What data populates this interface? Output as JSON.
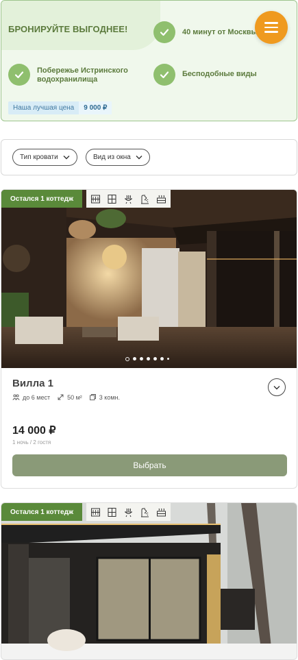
{
  "promo": {
    "title": "БРОНИРУЙТЕ ВЫГОДНЕЕ!",
    "features": [
      "40 минут от Москвы",
      "Побережье Истринского водохранилища",
      "Бесподобные виды"
    ],
    "price_label": "Наша лучшая цена",
    "price_value": "9 000 ₽"
  },
  "menu": {
    "icon": "hamburger-icon",
    "color": "#ef9a1f"
  },
  "filters": [
    {
      "label": "Тип кровати"
    },
    {
      "label": "Вид из окна"
    }
  ],
  "cards": [
    {
      "badge": "Остался 1 коттедж",
      "amenities": [
        "radiator-icon",
        "window-icon",
        "bbq-icon",
        "shower-icon",
        "sauna-icon"
      ],
      "slides_total": 7,
      "slide_active": 1,
      "name": "Вилла 1",
      "guests": "до 6 мест",
      "area": "50 м²",
      "rooms": "3 комн.",
      "price": "14 000 ₽",
      "price_note": "1 ночь / 2 гостя",
      "button": "Выбрать"
    },
    {
      "badge": "Остался 1 коттедж",
      "amenities": [
        "radiator-icon",
        "window-icon",
        "bbq-icon",
        "shower-icon",
        "sauna-icon"
      ]
    }
  ],
  "colors": {
    "accent_green": "#5a8a3a",
    "promo_bg": "#f0f8ec",
    "check_green": "#8fbf6e",
    "button_olive": "#8a9a78"
  }
}
